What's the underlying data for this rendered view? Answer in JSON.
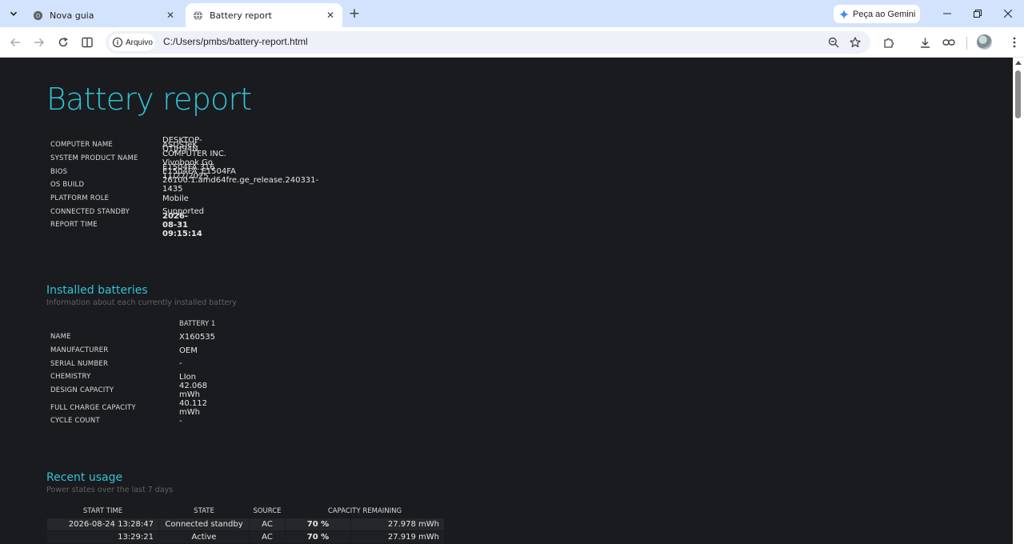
{
  "browser": {
    "tabs": [
      {
        "title": "Nova guia",
        "active": false
      },
      {
        "title": "Battery report",
        "active": true
      }
    ],
    "gemini_label": "Peça ao Gemini",
    "site_chip": "Arquivo",
    "url": "C:/Users/pmbs/battery-report.html"
  },
  "report": {
    "title": "Battery report",
    "system": [
      {
        "key": "COMPUTER NAME",
        "value": "DESKTOP-QTJH94N"
      },
      {
        "key": "SYSTEM PRODUCT NAME",
        "value": "ASUSTeK COMPUTER INC. Vivobook Go E1504FA_E1504FA"
      },
      {
        "key": "BIOS",
        "value": "E1504FA.316 11/27/2025"
      },
      {
        "key": "OS BUILD",
        "value": "26100.1.amd64fre.ge_release.240331-1435"
      },
      {
        "key": "PLATFORM ROLE",
        "value": "Mobile"
      },
      {
        "key": "CONNECTED STANDBY",
        "value": "Supported"
      },
      {
        "key": "REPORT TIME",
        "value": "2026-08-31   09:15:14"
      }
    ],
    "installed": {
      "title": "Installed batteries",
      "subtitle": "Information about each currently installed battery",
      "column": "BATTERY 1",
      "rows": [
        {
          "key": "NAME",
          "value": "X160535"
        },
        {
          "key": "MANUFACTURER",
          "value": "OEM"
        },
        {
          "key": "SERIAL NUMBER",
          "value": "-"
        },
        {
          "key": "CHEMISTRY",
          "value": "LIon"
        },
        {
          "key": "DESIGN CAPACITY",
          "value": "42.068 mWh"
        },
        {
          "key": "FULL CHARGE CAPACITY",
          "value": "40.112 mWh"
        },
        {
          "key": "CYCLE COUNT",
          "value": "-"
        }
      ]
    },
    "usage": {
      "title": "Recent usage",
      "subtitle": "Power states over the last 7 days",
      "headers": [
        "START TIME",
        "STATE",
        "SOURCE",
        "CAPACITY REMAINING"
      ],
      "rows": [
        {
          "start": "2026-08-24   13:28:47",
          "state": "Connected standby",
          "source": "AC",
          "percent": "70 %",
          "mwh": "27.978 mWh"
        },
        {
          "start": "13:29:21",
          "state": "Active",
          "source": "AC",
          "percent": "70 %",
          "mwh": "27.919 mWh"
        }
      ]
    }
  }
}
